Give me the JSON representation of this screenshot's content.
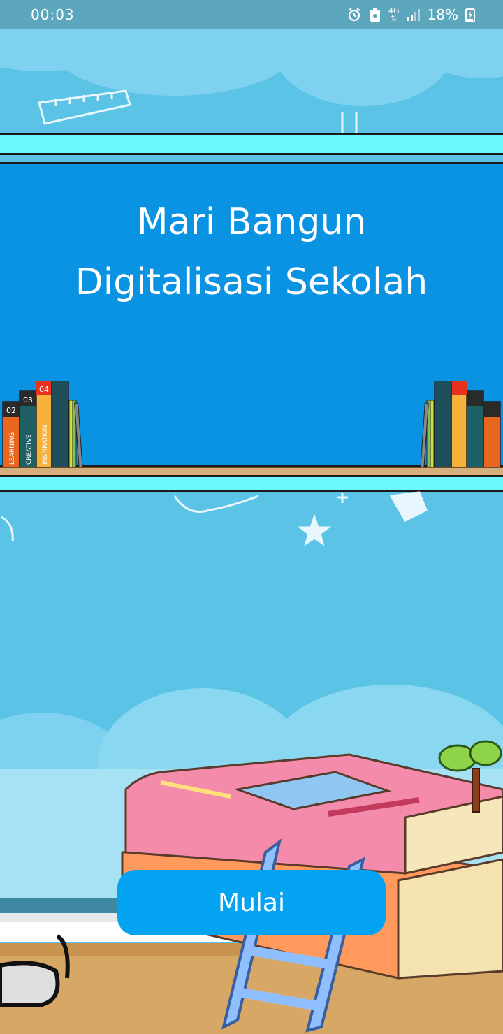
{
  "status_bar": {
    "time": "00:03",
    "network": "4G",
    "battery": "18%"
  },
  "board": {
    "title_line1": "Mari Bangun",
    "title_line2": "Digitalisasi Sekolah"
  },
  "books": {
    "spine_labels": [
      "02",
      "03",
      "04"
    ],
    "spine_words": [
      "LEARNING",
      "CREATIVE",
      "INSPIRATION"
    ]
  },
  "actions": {
    "start_label": "Mulai"
  },
  "colors": {
    "sky": "#5bc3e6",
    "board": "#0b93e3",
    "shelf": "#6df7ff",
    "button": "#03a3f2"
  }
}
